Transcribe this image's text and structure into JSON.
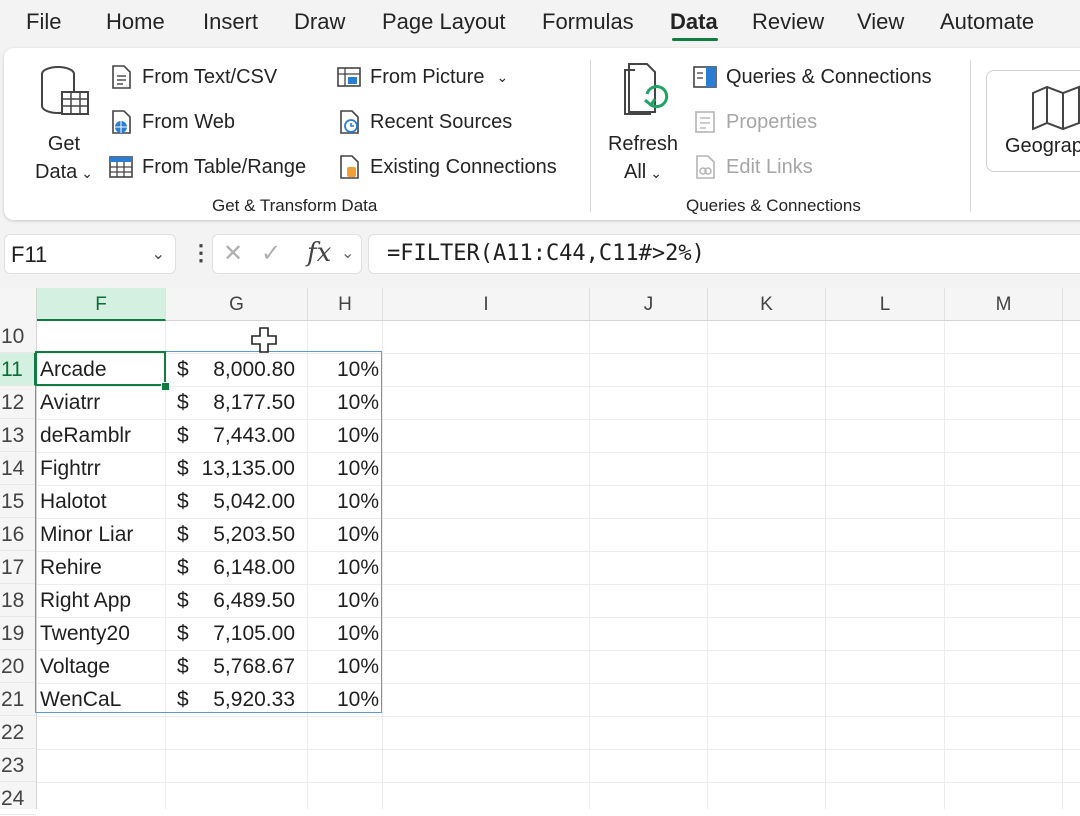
{
  "menu": {
    "tabs": [
      "File",
      "Home",
      "Insert",
      "Draw",
      "Page Layout",
      "Formulas",
      "Data",
      "Review",
      "View",
      "Automate"
    ],
    "active": "Data",
    "accent": "#107c41"
  },
  "ribbon": {
    "get_data": {
      "line1": "Get",
      "line2": "Data"
    },
    "from_text_csv": "From Text/CSV",
    "from_web": "From Web",
    "from_table_range": "From Table/Range",
    "from_picture": "From Picture",
    "recent_sources": "Recent Sources",
    "existing_connections": "Existing Connections",
    "group_get_transform": "Get & Transform Data",
    "refresh_all": {
      "line1": "Refresh",
      "line2": "All"
    },
    "queries_connections": "Queries & Connections",
    "properties": "Properties",
    "edit_links": "Edit Links",
    "group_queries": "Queries & Connections",
    "geography": "Geograp"
  },
  "formula_bar": {
    "name_box": "F11",
    "formula": "=FILTER(A11:C44,C11#>2%)",
    "fx": "fx"
  },
  "grid": {
    "columns": [
      "F",
      "G",
      "H",
      "I",
      "J",
      "K",
      "L",
      "M"
    ],
    "selected_column": "F",
    "rows": [
      "10",
      "11",
      "12",
      "13",
      "14",
      "15",
      "16",
      "17",
      "18",
      "19",
      "20",
      "21",
      "22",
      "23",
      "24"
    ],
    "selected_row": "11",
    "data": [
      {
        "name": "Arcade",
        "dollar": "$",
        "amount": "8,000.80",
        "pct": "10%"
      },
      {
        "name": "Aviatrr",
        "dollar": "$",
        "amount": "8,177.50",
        "pct": "10%"
      },
      {
        "name": "deRamblr",
        "dollar": "$",
        "amount": "7,443.00",
        "pct": "10%"
      },
      {
        "name": "Fightrr",
        "dollar": "$",
        "amount": "13,135.00",
        "pct": "10%"
      },
      {
        "name": "Halotot",
        "dollar": "$",
        "amount": "5,042.00",
        "pct": "10%"
      },
      {
        "name": "Minor Liar",
        "dollar": "$",
        "amount": "5,203.50",
        "pct": "10%"
      },
      {
        "name": "Rehire",
        "dollar": "$",
        "amount": "6,148.00",
        "pct": "10%"
      },
      {
        "name": "Right App",
        "dollar": "$",
        "amount": "6,489.50",
        "pct": "10%"
      },
      {
        "name": "Twenty20",
        "dollar": "$",
        "amount": "7,105.00",
        "pct": "10%"
      },
      {
        "name": "Voltage",
        "dollar": "$",
        "amount": "5,768.67",
        "pct": "10%"
      },
      {
        "name": "WenCaL",
        "dollar": "$",
        "amount": "5,920.33",
        "pct": "10%"
      }
    ]
  }
}
